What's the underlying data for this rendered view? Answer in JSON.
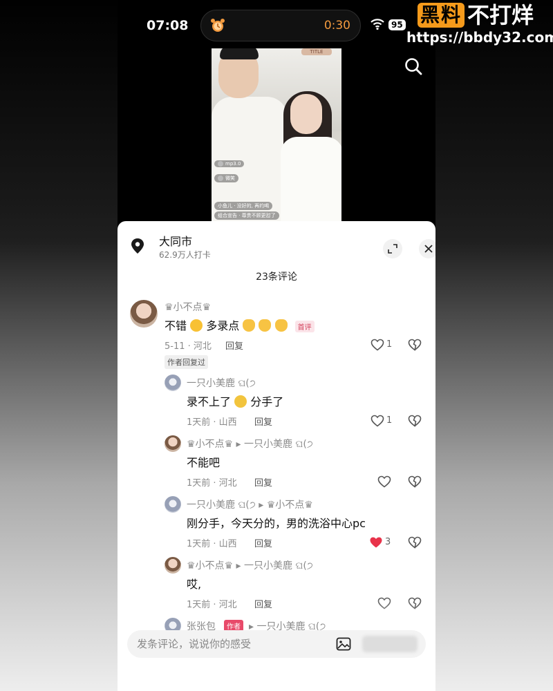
{
  "watermark": {
    "badge": "黑料",
    "text": "不打烊",
    "url": "https://bbdy32.com"
  },
  "status": {
    "time": "07:08",
    "timer": "0:30",
    "battery": "95"
  },
  "video": {
    "tag": "TITLE",
    "chat": [
      "mp3.0",
      "微笑",
      "小鱼儿 · 没好的, 再约喝",
      "组合宣告 · 尊贵不顾更怼了"
    ]
  },
  "location": {
    "name": "大同市",
    "checkins": "62.9万人打卡"
  },
  "comment_count": "23条评论",
  "comments": [
    {
      "user": "♛小不点♛",
      "text_a": "不错",
      "text_b": "多录点",
      "badge": "首评",
      "meta": "5-11 · 河北",
      "reply": "回复",
      "likes": "1",
      "author_tag": "作者回复过"
    },
    {
      "user": "一只小美鹿 ଘ(੭",
      "text_a": "录不上了",
      "text_b": "分手了",
      "meta": "1天前 · 山西",
      "reply": "回复",
      "likes": "1"
    },
    {
      "user": "♛小不点♛ ▸ 一只小美鹿 ଘ(੭",
      "text": "不能吧",
      "meta": "1天前 · 河北",
      "reply": "回复"
    },
    {
      "user": "一只小美鹿 ଘ(੭ ▸ ♛小不点♛",
      "text": "刚分手，今天分的，男的洗浴中心pc",
      "meta": "1天前 · 山西",
      "reply": "回复",
      "likes": "3"
    },
    {
      "user": "♛小不点♛ ▸ 一只小美鹿 ଘ(੭",
      "text": "哎,",
      "meta": "1天前 · 河北",
      "reply": "回复"
    }
  ],
  "partial_user": "张张包",
  "partial_tag": "作者",
  "partial_target": "▸ 一只小美鹿 ଘ(੭",
  "input": {
    "placeholder": "发条评论，说说你的感受"
  },
  "colors": {
    "liked_heart": "#e8334a",
    "accent_badge": "#d3425c"
  }
}
